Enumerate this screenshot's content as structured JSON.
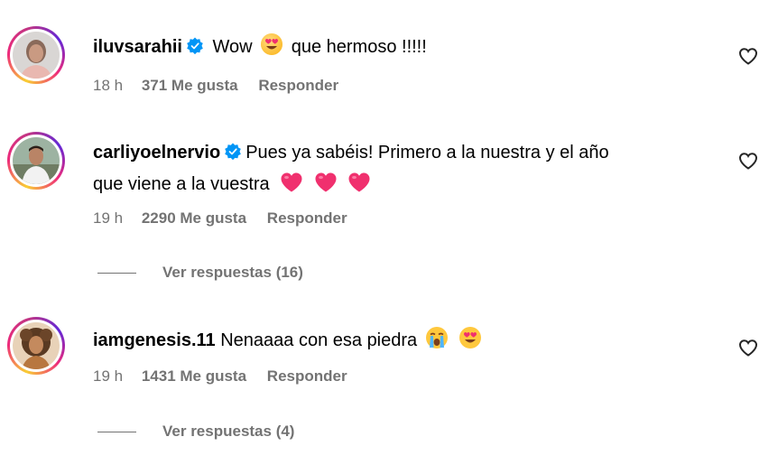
{
  "comments": [
    {
      "username": "iluvsarahii",
      "verified": true,
      "text_parts": [
        "Wow",
        "que hermoso !!!!!"
      ],
      "time": "18 h",
      "likes": "371 Me gusta",
      "reply_label": "Responder"
    },
    {
      "username": "carliyoelnervio",
      "verified": true,
      "text_line1": "Pues ya sabéis! Primero a la nuestra y el año",
      "text_line2": "que viene a la vuestra",
      "time": "19 h",
      "likes": "2290 Me gusta",
      "reply_label": "Responder",
      "view_replies": "Ver respuestas (16)"
    },
    {
      "username": "iamgenesis.11",
      "verified": false,
      "text": "Nenaaaa con esa piedra",
      "time": "19 h",
      "likes": "1431 Me gusta",
      "reply_label": "Responder",
      "view_replies": "Ver respuestas (4)"
    }
  ],
  "icons": {
    "like": "heart-outline-icon",
    "verified": "verified-badge-icon",
    "emoji_heart_eyes": "smiling-face-with-heart-eyes-emoji",
    "emoji_heart": "red-heart-emoji",
    "emoji_crying": "loudly-crying-face-emoji"
  },
  "colors": {
    "verified": "#0095f6",
    "meta_text": "#737373",
    "heart_emoji": "#f0306e"
  }
}
